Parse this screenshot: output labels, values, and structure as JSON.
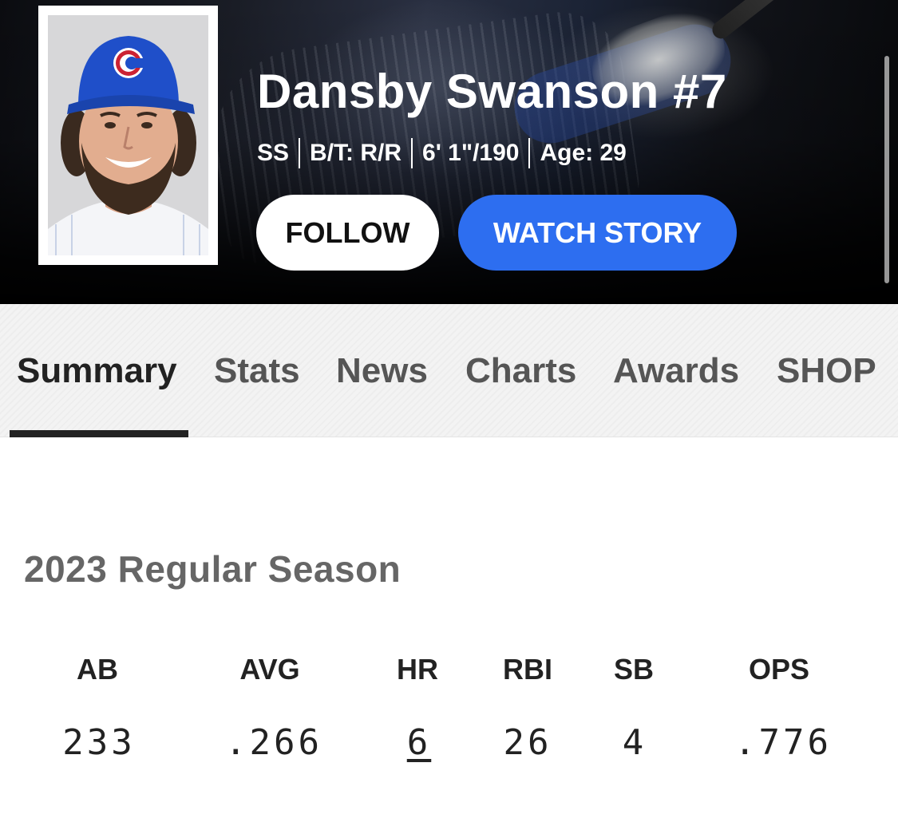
{
  "player": {
    "name": "Dansby Swanson #7",
    "meta": [
      "SS",
      "B/T: R/R",
      "6' 1\"/190",
      "Age: 29"
    ]
  },
  "buttons": {
    "follow": "FOLLOW",
    "watch_story": "WATCH STORY"
  },
  "tabs": [
    {
      "label": "Summary",
      "active": true
    },
    {
      "label": "Stats",
      "active": false
    },
    {
      "label": "News",
      "active": false
    },
    {
      "label": "Charts",
      "active": false
    },
    {
      "label": "Awards",
      "active": false
    },
    {
      "label": "SHOP",
      "active": false
    }
  ],
  "season": {
    "title": "2023 Regular Season",
    "stats": [
      {
        "label": "AB",
        "value": "233"
      },
      {
        "label": "AVG",
        "value": ".266"
      },
      {
        "label": "HR",
        "value": "6"
      },
      {
        "label": "RBI",
        "value": "26"
      },
      {
        "label": "SB",
        "value": "4"
      },
      {
        "label": "OPS",
        "value": ".776"
      }
    ]
  },
  "colors": {
    "accent_blue": "#2d6ef0",
    "cap_blue": "#1f4fc9",
    "logo_red": "#cc2233",
    "tab_indicator": "#222222"
  }
}
